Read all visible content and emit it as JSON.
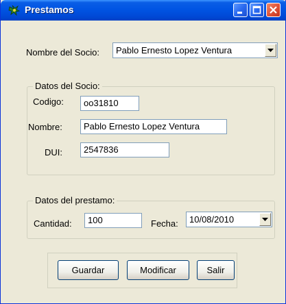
{
  "window": {
    "title": "Prestamos"
  },
  "socio_select": {
    "label": "Nombre del Socio:",
    "selected": "Pablo Ernesto  Lopez  Ventura"
  },
  "datos_socio": {
    "legend": "Datos del Socio:",
    "codigo": {
      "label": "Codigo:",
      "value": "oo31810"
    },
    "nombre": {
      "label": "Nombre:",
      "value": "Pablo Ernesto  Lopez  Ventura"
    },
    "dui": {
      "label": "DUI:",
      "value": "2547836"
    }
  },
  "datos_prestamo": {
    "legend": "Datos del prestamo:",
    "cantidad": {
      "label": "Cantidad:",
      "value": "100"
    },
    "fecha": {
      "label": "Fecha:",
      "value": "10/08/2010"
    }
  },
  "buttons": {
    "guardar": "Guardar",
    "modificar": "Modificar",
    "salir": "Salir"
  }
}
